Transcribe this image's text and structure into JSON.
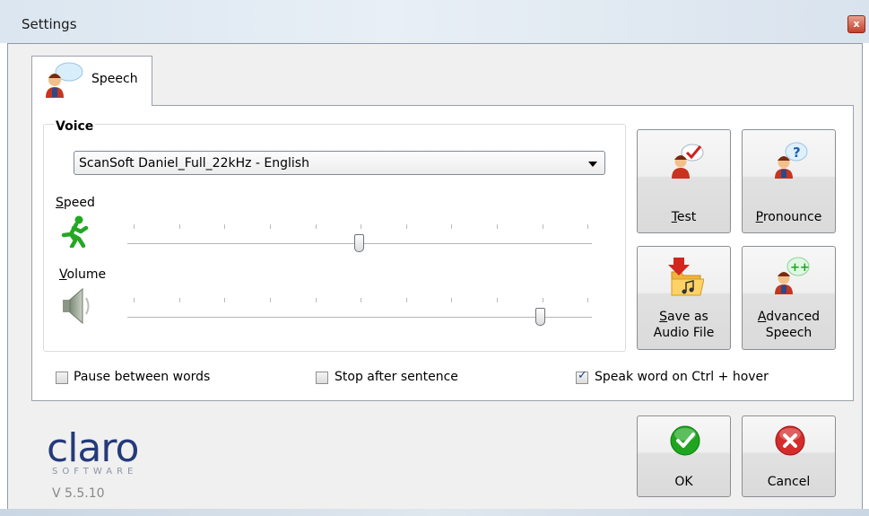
{
  "window": {
    "title": "Settings",
    "close_glyph": "x"
  },
  "tabs": [
    {
      "label": "Speech",
      "icon": "speaking-person-icon"
    }
  ],
  "voice": {
    "group_label": "Voice",
    "selected_voice": "ScanSoft Daniel_Full_22kHz - English",
    "speed_label_ul": "S",
    "speed_label_rest": "peed",
    "speed_value": 0.5,
    "volume_label_ul": "V",
    "volume_label_rest": "olume",
    "volume_value": 0.88,
    "speed_icon": "running-man-icon",
    "volume_icon": "speaker-icon"
  },
  "buttons": {
    "test": {
      "ul": "T",
      "rest": "est",
      "icon": "speech-check-icon"
    },
    "pronounce": {
      "ul": "P",
      "rest": "ronounce",
      "icon": "speech-question-icon"
    },
    "save_audio": {
      "line1_ul": "S",
      "line1_rest": "ave as",
      "line2": "Audio File",
      "icon": "save-folder-icon"
    },
    "advanced": {
      "line1_ul": "A",
      "line1_rest": "dvanced",
      "line2": "Speech",
      "icon": "speech-plus-icon"
    },
    "ok": {
      "label": "OK",
      "icon": "green-check-icon"
    },
    "cancel": {
      "label": "Cancel",
      "icon": "red-x-icon"
    }
  },
  "options": [
    {
      "label": "Pause between words",
      "checked": false
    },
    {
      "label": "Stop after sentence",
      "checked": false
    },
    {
      "label": "Speak word on Ctrl + hover",
      "checked": true
    }
  ],
  "logo": {
    "text": "claro",
    "subtext": "SOFTWARE"
  },
  "version": "V 5.5.10",
  "colors": {
    "accent_green": "#1fa51f",
    "cancel_red": "#d42b2b",
    "logo_blue": "#253a7a"
  }
}
